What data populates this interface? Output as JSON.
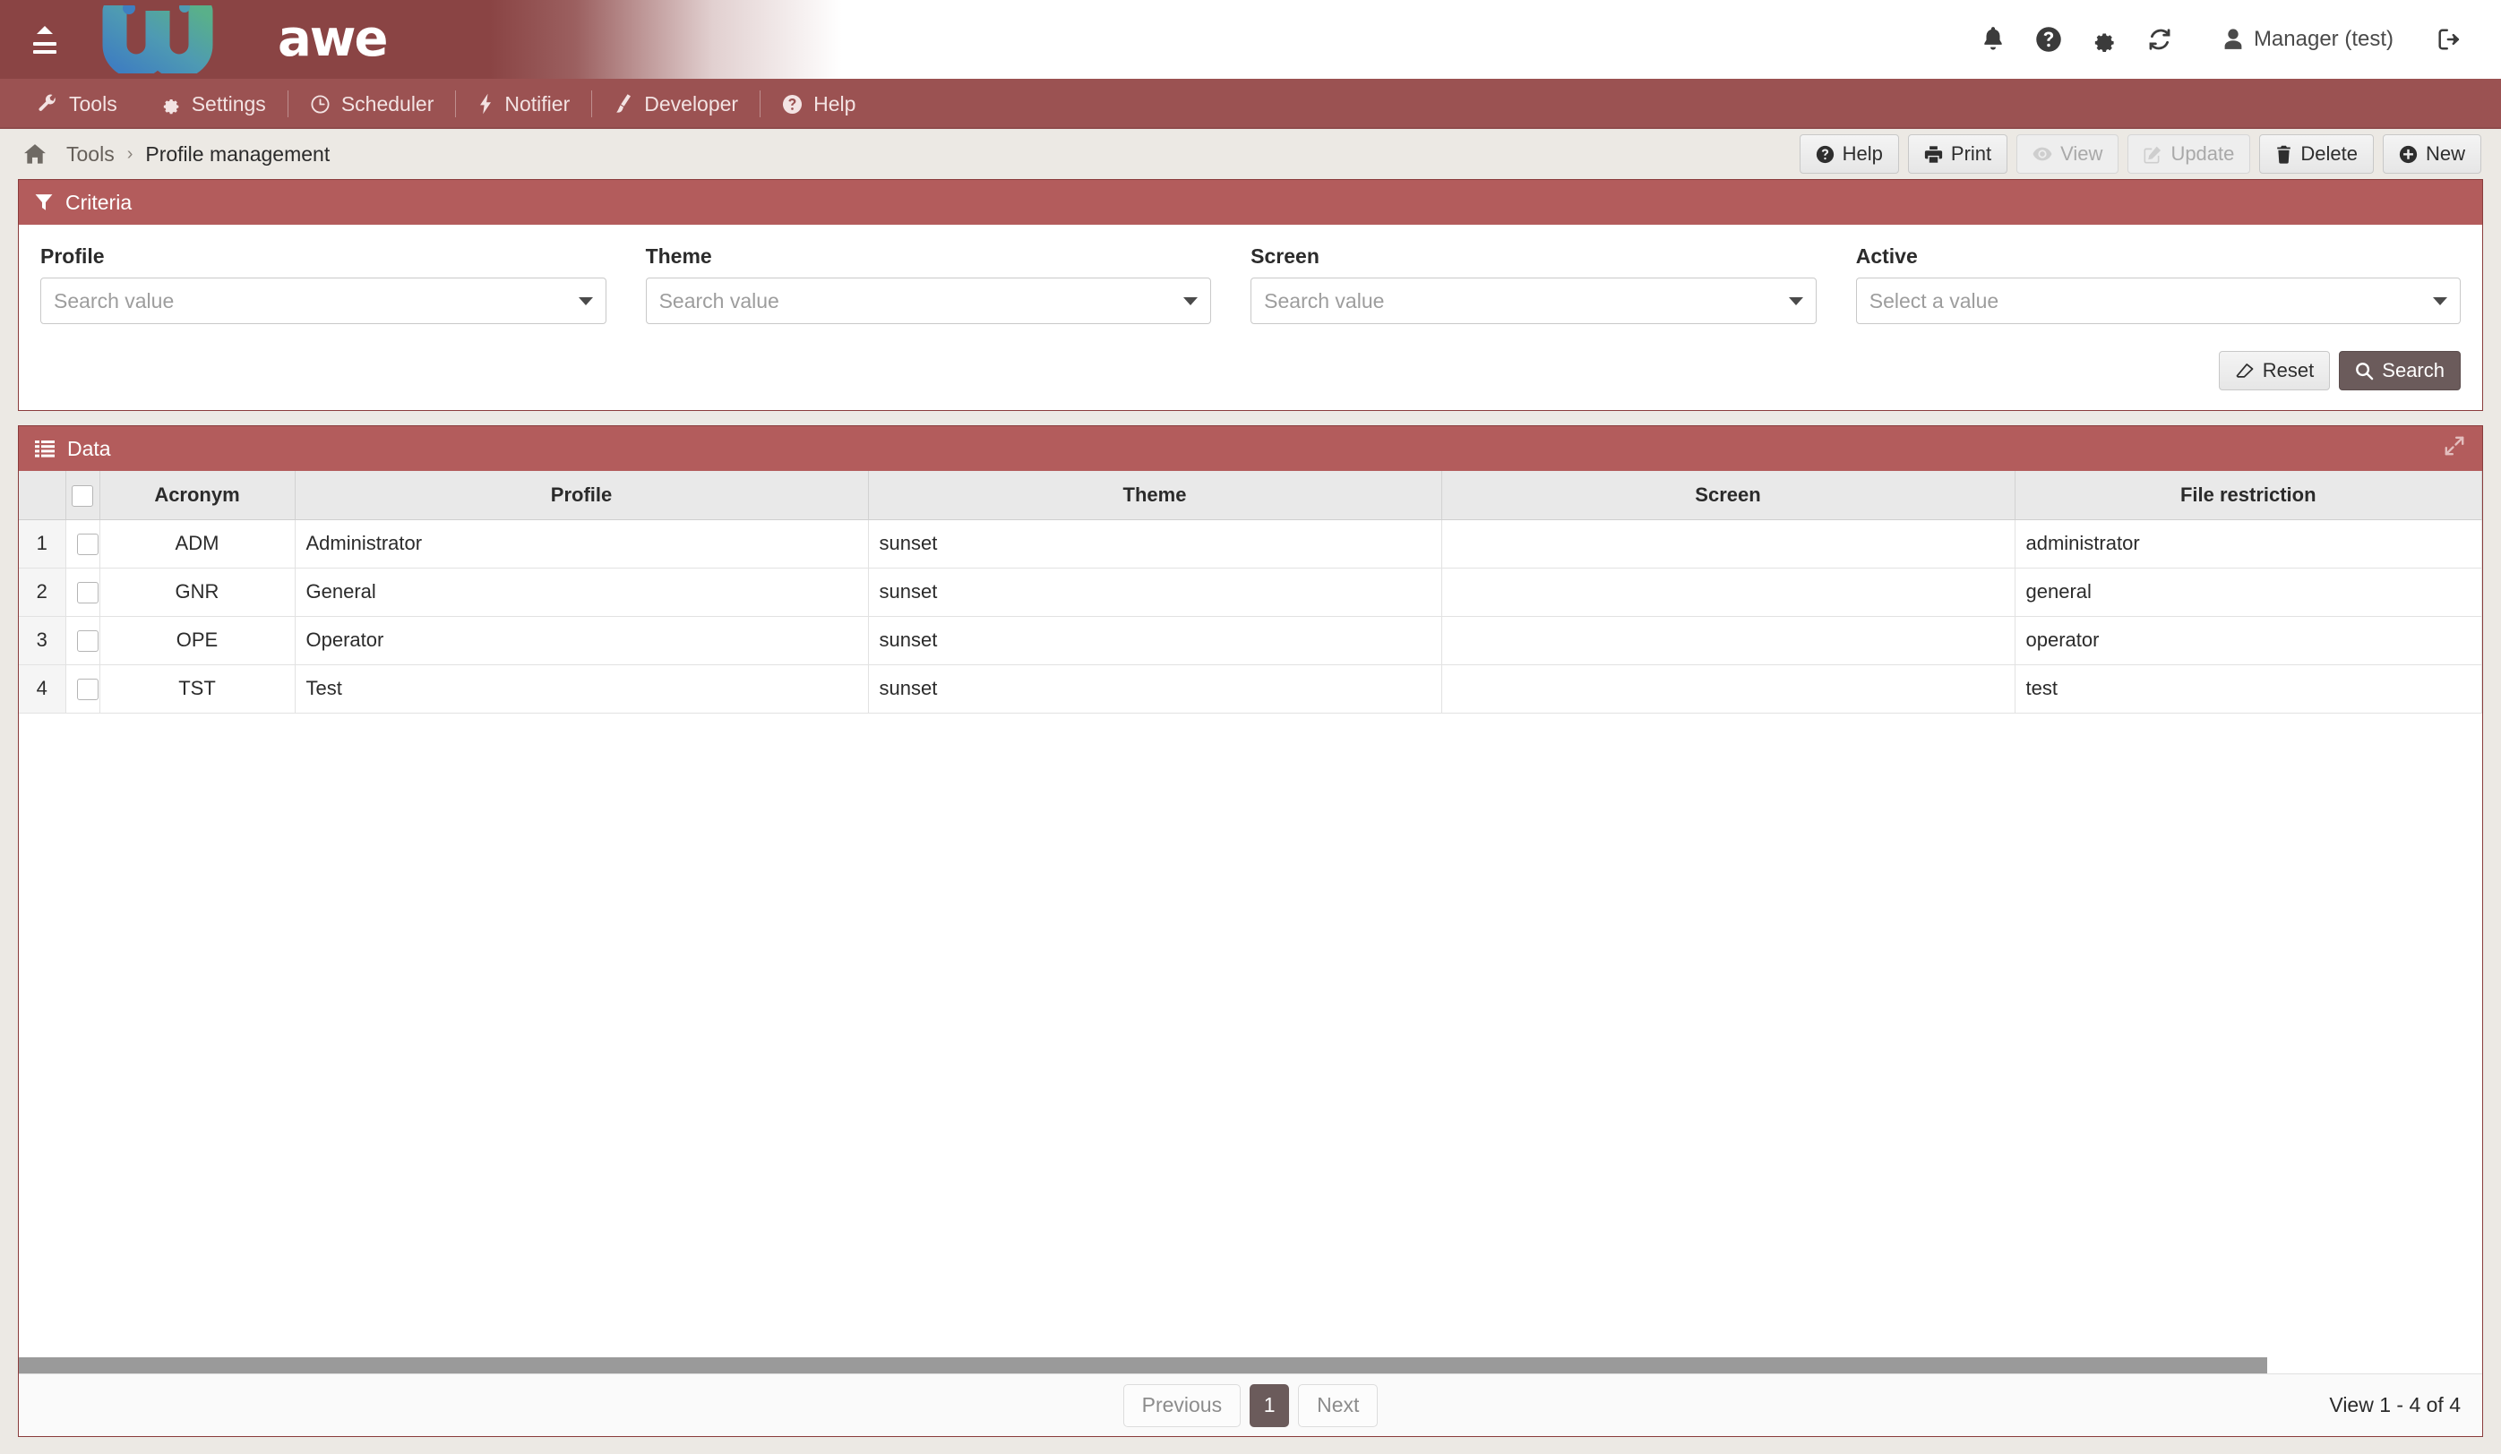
{
  "header": {
    "brand": "awe",
    "menu_icon": "hamburger-icon",
    "icons": [
      {
        "name": "bell-icon",
        "title": "Notifications"
      },
      {
        "name": "help-circle-icon",
        "title": "Help"
      },
      {
        "name": "gear-icon",
        "title": "Settings"
      },
      {
        "name": "refresh-icon",
        "title": "Reload"
      }
    ],
    "user": "Manager (test)",
    "logout_icon": "logout-icon"
  },
  "menubar": {
    "items": [
      {
        "label": "Tools",
        "icon": "wrench-icon"
      },
      {
        "label": "Settings",
        "icon": "gear-icon"
      },
      {
        "label": "Scheduler",
        "icon": "clock-icon"
      },
      {
        "label": "Notifier",
        "icon": "bolt-icon"
      },
      {
        "label": "Developer",
        "icon": "paintbrush-icon"
      },
      {
        "label": "Help",
        "icon": "help-circle-icon"
      }
    ]
  },
  "breadcrumb": {
    "home_icon": "home-icon",
    "parent": "Tools",
    "separator": "›",
    "current": "Profile management"
  },
  "toolbar": {
    "buttons": [
      {
        "label": "Help",
        "icon": "help-circle-icon",
        "disabled": false
      },
      {
        "label": "Print",
        "icon": "printer-icon",
        "disabled": false
      },
      {
        "label": "View",
        "icon": "eye-icon",
        "disabled": true
      },
      {
        "label": "Update",
        "icon": "pencil-square-icon",
        "disabled": true
      },
      {
        "label": "Delete",
        "icon": "trash-icon",
        "disabled": false
      },
      {
        "label": "New",
        "icon": "plus-circle-icon",
        "disabled": false
      }
    ]
  },
  "criteria": {
    "title": "Criteria",
    "icon": "filter-icon",
    "fields": [
      {
        "label": "Profile",
        "placeholder": "Search value",
        "value": ""
      },
      {
        "label": "Theme",
        "placeholder": "Search value",
        "value": ""
      },
      {
        "label": "Screen",
        "placeholder": "Search value",
        "value": ""
      },
      {
        "label": "Active",
        "placeholder": "Select a value",
        "value": ""
      }
    ],
    "reset_label": "Reset",
    "reset_icon": "eraser-icon",
    "search_label": "Search",
    "search_icon": "magnifier-icon"
  },
  "data": {
    "title": "Data",
    "icon": "list-icon",
    "expand_icon": "expand-arrows-icon",
    "columns": [
      "Acronym",
      "Profile",
      "Theme",
      "Screen",
      "File restriction"
    ],
    "rows": [
      {
        "index": "1",
        "acronym": "ADM",
        "profile": "Administrator",
        "theme": "sunset",
        "screen": "",
        "file_restriction": "administrator",
        "checked": false
      },
      {
        "index": "2",
        "acronym": "GNR",
        "profile": "General",
        "theme": "sunset",
        "screen": "",
        "file_restriction": "general",
        "checked": false
      },
      {
        "index": "3",
        "acronym": "OPE",
        "profile": "Operator",
        "theme": "sunset",
        "screen": "",
        "file_restriction": "operator",
        "checked": false
      },
      {
        "index": "4",
        "acronym": "TST",
        "profile": "Test",
        "theme": "sunset",
        "screen": "",
        "file_restriction": "test",
        "checked": false
      }
    ]
  },
  "pager": {
    "previous_label": "Previous",
    "current_page": "1",
    "next_label": "Next",
    "summary": "View 1 - 4 of 4"
  },
  "colors": {
    "brand_dark_red": "#8a4444",
    "menubar_red": "#9b5252",
    "panel_header_red": "#b35c5c",
    "panel_border_red": "#8a3c3c",
    "page_bg": "#ece9e4",
    "accent_dark": "#6b5b5b"
  }
}
